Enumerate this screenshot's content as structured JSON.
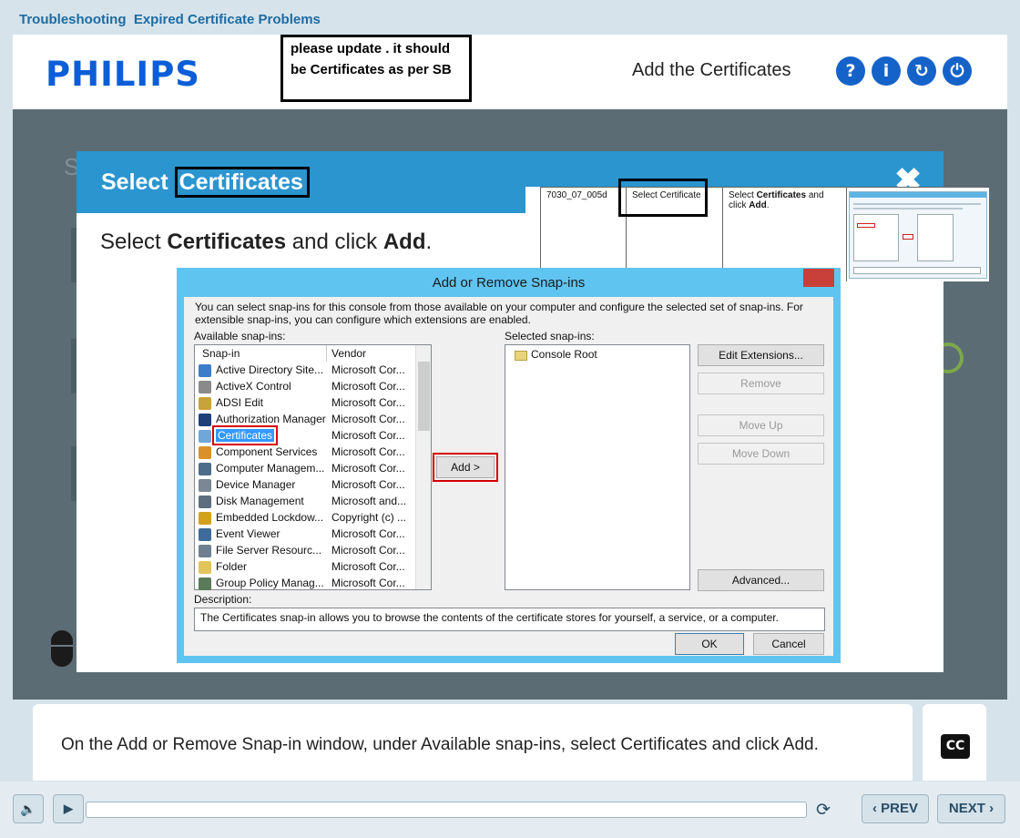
{
  "course": {
    "title": "Troubleshooting  Expired Certificate Problems"
  },
  "header": {
    "logo": "PHILIPS",
    "review_note": "please update . it should be Certificates as per SB",
    "screen_title": "Add the Certificates",
    "buttons": {
      "help": "?",
      "info": "i",
      "replay": "↻",
      "exit": "⏻"
    }
  },
  "slide": {
    "title_prefix": "Select ",
    "title_highlight": "Certificates",
    "close": "✖",
    "instruction": {
      "pre": "Select ",
      "bold1": "Certificates",
      "mid": " and click ",
      "bold2": "Add",
      "post": "."
    }
  },
  "reference_table": {
    "id": "7030_07_005d",
    "step": "Select Certificate",
    "action_pre": "Select ",
    "action_bold1": "Certificates",
    "action_mid": " and click ",
    "action_bold2": "Add",
    "action_post": "."
  },
  "dialog": {
    "title": "Add or Remove Snap-ins",
    "intro": "You can select snap-ins for this console from those available on your computer and configure the selected set of snap-ins. For extensible snap-ins, you can configure which extensions are enabled.",
    "available_label": "Available snap-ins:",
    "selected_label": "Selected snap-ins:",
    "col_snapin": "Snap-in",
    "col_vendor": "Vendor",
    "snapins": [
      {
        "name": "Active Directory Site...",
        "vendor": "Microsoft Cor...",
        "color": "#3d7cc9"
      },
      {
        "name": "ActiveX Control",
        "vendor": "Microsoft Cor...",
        "color": "#8a8a8a"
      },
      {
        "name": "ADSI Edit",
        "vendor": "Microsoft Cor...",
        "color": "#c8a23a"
      },
      {
        "name": "Authorization Manager",
        "vendor": "Microsoft Cor...",
        "color": "#1f3f7a"
      },
      {
        "name": "Certificates",
        "vendor": "Microsoft Cor...",
        "color": "#6ea7d8"
      },
      {
        "name": "Component Services",
        "vendor": "Microsoft Cor...",
        "color": "#d9922b"
      },
      {
        "name": "Computer Managem...",
        "vendor": "Microsoft Cor...",
        "color": "#4d6b8a"
      },
      {
        "name": "Device Manager",
        "vendor": "Microsoft Cor...",
        "color": "#7b8794"
      },
      {
        "name": "Disk Management",
        "vendor": "Microsoft and...",
        "color": "#5c6d7d"
      },
      {
        "name": "Embedded Lockdow...",
        "vendor": "Copyright (c) ...",
        "color": "#d4a21a"
      },
      {
        "name": "Event Viewer",
        "vendor": "Microsoft Cor...",
        "color": "#3f6a9c"
      },
      {
        "name": "File Server Resourc...",
        "vendor": "Microsoft Cor...",
        "color": "#6f7f8f"
      },
      {
        "name": "Folder",
        "vendor": "Microsoft Cor...",
        "color": "#e2c55a"
      },
      {
        "name": "Group Policy Manag...",
        "vendor": "Microsoft Cor...",
        "color": "#5a7a5a"
      }
    ],
    "selected_snapins": [
      "Console Root"
    ],
    "add_button": "Add >",
    "edit_extensions": "Edit Extensions...",
    "remove": "Remove",
    "move_up": "Move Up",
    "move_down": "Move Down",
    "advanced": "Advanced...",
    "description_label": "Description:",
    "description": "The Certificates snap-in allows you to browse the contents of the certificate stores for yourself, a service, or a computer.",
    "ok": "OK",
    "cancel": "Cancel"
  },
  "caption": {
    "text": "On the Add or Remove Snap-in window, under Available snap-ins, select Certificates and click Add.",
    "cc": "CC"
  },
  "player": {
    "mute": "🔈",
    "play": "▶",
    "progress": 0.0,
    "replay": "⟳",
    "prev": "‹ PREV",
    "next": "NEXT ›"
  },
  "colors": {
    "brand_blue": "#0b5ed7",
    "slide_header": "#2a95cf",
    "dialog_frame": "#60c4f1",
    "highlight_red": "#d40000"
  }
}
